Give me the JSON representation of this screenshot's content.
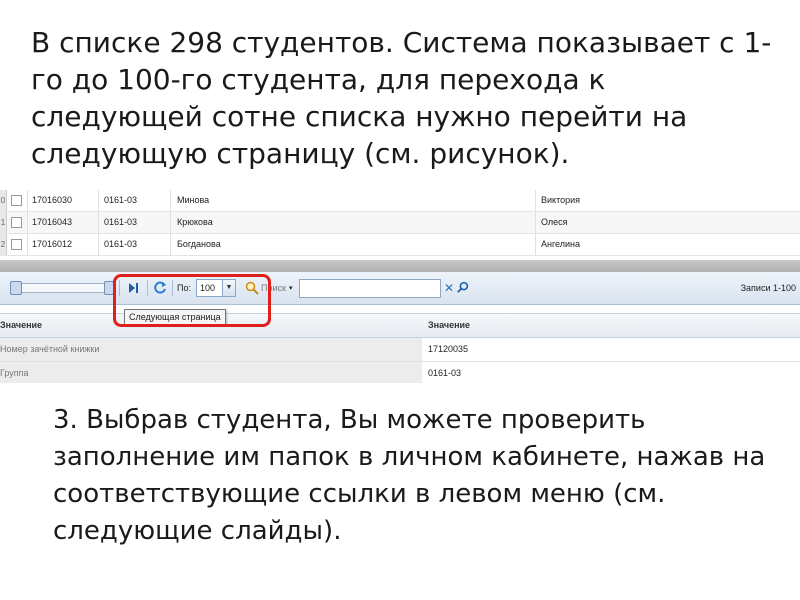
{
  "slide": {
    "heading": "В списке 298 студентов. Система показывает с 1-го до 100-го студента, для перехода к следующей сотне списка нужно перейти на следующую страницу (см. рисунок).",
    "body": "3. Выбрав студента, Вы можете проверить заполнение им папок в личном кабинете, нажав на соответствующие ссылки в левом меню (см. следующие слайды)."
  },
  "grid": {
    "rows": [
      {
        "num": "0",
        "id": "17016030",
        "group": "0161-03",
        "last_name": "Минова",
        "first_name": "Виктория"
      },
      {
        "num": "1",
        "id": "17016043",
        "group": "0161-03",
        "last_name": "Крюкова",
        "first_name": "Олеся"
      },
      {
        "num": "2",
        "id": "17016012",
        "group": "0161-03",
        "last_name": "Богданова",
        "first_name": "Ангелина"
      }
    ]
  },
  "toolbar": {
    "next_page_icon": "next-page-icon",
    "refresh_icon": "refresh-icon",
    "page_size_label": "По:",
    "page_size_value": "100",
    "search_label": "Поиск",
    "search_value": "",
    "records_label": "Записи 1-100"
  },
  "tooltip": {
    "text": "Следующая страница"
  },
  "properties": {
    "col_name": "Значение",
    "col_value": "Значение",
    "rows": [
      {
        "name": "Номер зачётной книжки",
        "value": "17120035"
      },
      {
        "name": "Группа",
        "value": "0161-03"
      }
    ]
  },
  "colors": {
    "highlight": "#e0201a",
    "accent": "#1e5fa8"
  }
}
